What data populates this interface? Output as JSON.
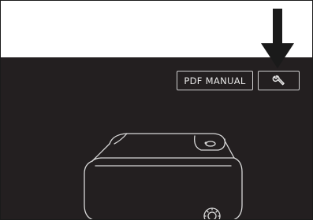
{
  "toolbar": {
    "pdf_manual_label": "PDF MANUAL",
    "settings_icon": "wrench-icon"
  },
  "annotation": {
    "pointer": "arrow-down-icon",
    "color": "#1a1a1a"
  },
  "screen": {
    "background": "#231f20",
    "button_border": "#cfcfcf",
    "illustration": "projector-icon"
  }
}
